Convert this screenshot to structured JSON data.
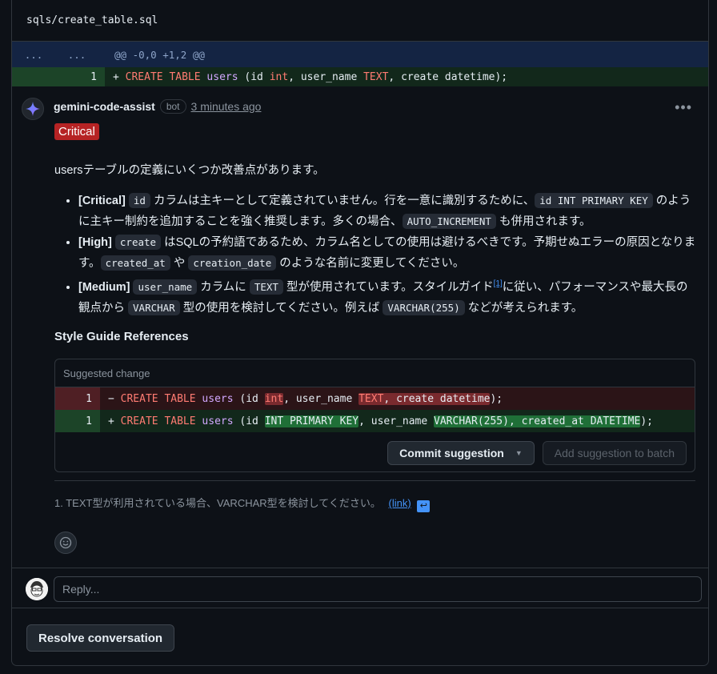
{
  "file": {
    "path": "sqls/create_table.sql"
  },
  "hunk": {
    "left": "...",
    "right": "...",
    "text": "@@ -0,0 +1,2 @@"
  },
  "diff": {
    "line_no": "1",
    "sign": "+"
  },
  "comment": {
    "author": "gemini-code-assist",
    "bot_label": "bot",
    "time": "3 minutes ago",
    "more_label": "•••",
    "severity": "Critical",
    "intro": "usersテーブルの定義にいくつか改善点があります。",
    "items": [
      {
        "tag": "[Critical]",
        "c1": "id",
        "t1": " カラムは主キーとして定義されていません。行を一意に識別するために、",
        "c2": "id INT PRIMARY KEY",
        "t2": " のように主キー制約を追加することを強く推奨します。多くの場合、",
        "c3": "AUTO_INCREMENT",
        "t3": " も併用されます。"
      },
      {
        "tag": "[High]",
        "c1": "create",
        "t1": " はSQLの予約語であるため、カラム名としての使用は避けるべきです。予期せぬエラーの原因となります。",
        "c2": "created_at",
        "t2": " や ",
        "c3": "creation_date",
        "t3": " のような名前に変更してください。"
      },
      {
        "tag": "[Medium]",
        "c1": "user_name",
        "t1": " カラムに ",
        "c2": "TEXT",
        "t2": " 型が使用されています。スタイルガイド",
        "ref": "[1]",
        "t3": "に従い、パフォーマンスや最大長の観点から ",
        "c3": "VARCHAR",
        "t4": " 型の使用を検討してください。例えば ",
        "c4": "VARCHAR(255)",
        "t5": " などが考えられます。"
      }
    ],
    "style_guide_title": "Style Guide References",
    "suggestion": {
      "header": "Suggested change",
      "del_line_no": "1",
      "add_line_no": "1",
      "del_sign": "−",
      "add_sign": "+",
      "commit_label": "Commit suggestion",
      "batch_label": "Add suggestion to batch"
    },
    "footnote": {
      "text": "1. TEXT型が利用されている場合、VARCHAR型を検討してください。",
      "link": "(link)"
    }
  },
  "code": {
    "create": "CREATE",
    "table": "TABLE",
    "users": "users",
    "paren_id": "(id ",
    "int": "int",
    "int_upper": "INT PRIMARY KEY",
    "comma_user": ", user_name ",
    "text": "TEXT",
    "orig_tail": ", create datetime",
    "varchar": "VARCHAR(255), created_at DATETIME",
    "end": ");"
  },
  "reply": {
    "placeholder": "Reply..."
  },
  "resolve_label": "Resolve conversation",
  "colors": {
    "critical": "#b62324",
    "link": "#4493f8",
    "keyword": "#ff7b72",
    "identifier": "#d2a8ff"
  }
}
